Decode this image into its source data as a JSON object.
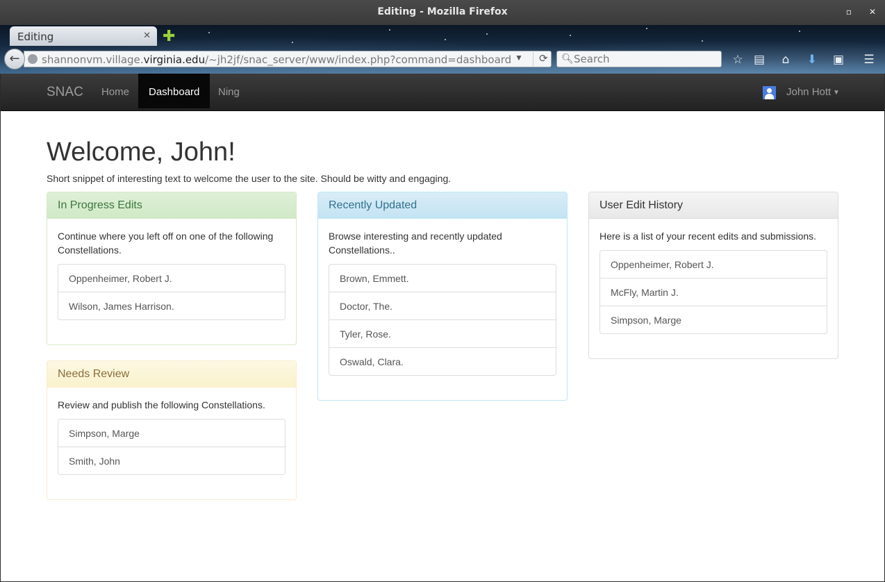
{
  "window": {
    "title": "Editing - Mozilla Firefox"
  },
  "browser": {
    "tab_title": "Editing",
    "url_prefix": "shannonvm.village.",
    "url_domain": "virginia.edu",
    "url_path": "/~jh2jf/snac_server/www/index.php?command=dashboard",
    "search_placeholder": "Search"
  },
  "navbar": {
    "brand": "SNAC",
    "links": [
      "Home",
      "Dashboard",
      "Ning"
    ],
    "active": "Dashboard",
    "user_name": "John Hott"
  },
  "main": {
    "heading": "Welcome, John!",
    "lead": "Short snippet of interesting text to welcome the user to the site. Should be witty and engaging."
  },
  "panels": {
    "in_progress": {
      "title": "In Progress Edits",
      "text": "Continue where you left off on one of the following Constellations.",
      "items": [
        "Oppenheimer, Robert J.",
        "Wilson, James Harrison."
      ]
    },
    "needs_review": {
      "title": "Needs Review",
      "text": "Review and publish the following Constellations.",
      "items": [
        "Simpson, Marge",
        "Smith, John"
      ]
    },
    "recently_updated": {
      "title": "Recently Updated",
      "text": "Browse interesting and recently updated Constellations..",
      "items": [
        "Brown, Emmett.",
        "Doctor, The.",
        "Tyler, Rose.",
        "Oswald, Clara."
      ]
    },
    "edit_history": {
      "title": "User Edit History",
      "text": "Here is a list of your recent edits and submissions.",
      "items": [
        "Oppenheimer, Robert J.",
        "McFly, Martin J.",
        "Simpson, Marge"
      ]
    }
  },
  "colors": {
    "success_heading": "#3c763d",
    "warning_heading": "#8a6d3b",
    "info_heading": "#31708f",
    "navbar_bg": "#222222"
  },
  "icons": [
    "back-arrow-icon",
    "globe-icon",
    "dropdown-icon",
    "reload-icon",
    "search-icon",
    "bookmark-star-icon",
    "reading-list-icon",
    "home-icon",
    "download-icon",
    "screenshot-icon",
    "menu-icon",
    "user-avatar-icon"
  ]
}
